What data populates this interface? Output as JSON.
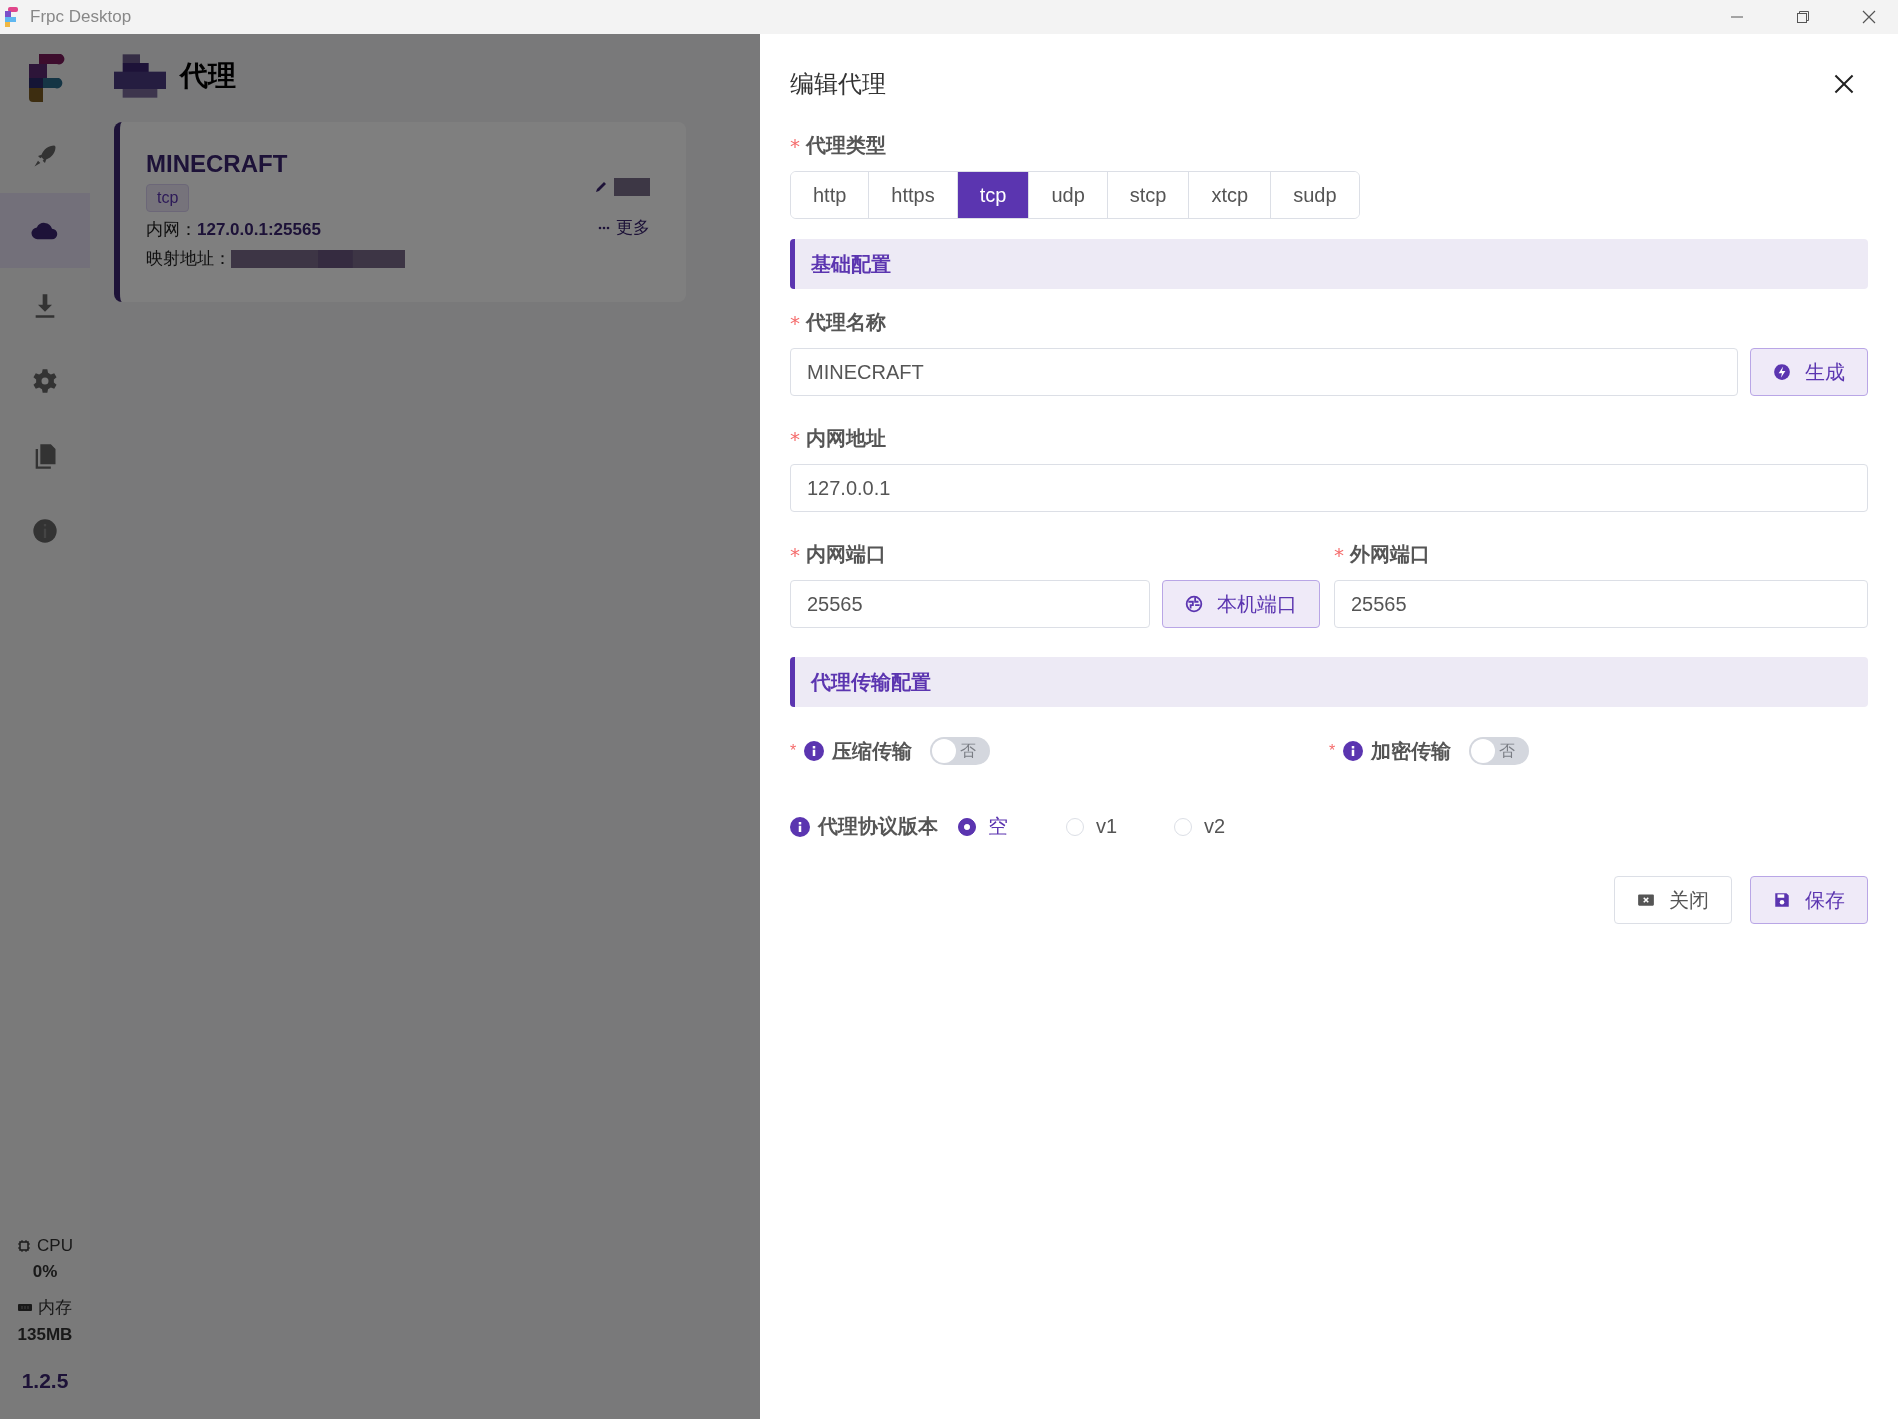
{
  "window": {
    "title": "Frpc Desktop"
  },
  "sidebar": {
    "items": [
      {
        "selected": false
      },
      {
        "selected": true
      },
      {
        "selected": false
      },
      {
        "selected": false
      },
      {
        "selected": false
      },
      {
        "selected": false
      }
    ],
    "stats": [
      {
        "kind": "cpu",
        "label": "CPU",
        "value": "0%"
      },
      {
        "kind": "memory",
        "label": "内存",
        "value": "135MB"
      }
    ],
    "version": "1.2.5"
  },
  "page": {
    "title": "代理",
    "card": {
      "name": "MINECRAFT",
      "tag": "tcp",
      "local_label": "内网：",
      "local_value": "127.0.0.1:25565",
      "mapping_label": "映射地址：",
      "more": "更多"
    }
  },
  "drawer": {
    "title": "编辑代理",
    "type_field": {
      "label": "代理类型",
      "mark": "*",
      "options": [
        {
          "label": "http",
          "selected": false
        },
        {
          "label": "https",
          "selected": false
        },
        {
          "label": "tcp",
          "selected": true
        },
        {
          "label": "udp",
          "selected": false
        },
        {
          "label": "stcp",
          "selected": false
        },
        {
          "label": "xtcp",
          "selected": false
        },
        {
          "label": "sudp",
          "selected": false
        }
      ]
    },
    "section_basic": "基础配置",
    "name_field": {
      "label": "代理名称",
      "mark": "*",
      "value": "MINECRAFT",
      "button": "生成"
    },
    "address_field": {
      "label": "内网地址",
      "mark": "*",
      "value": "127.0.0.1"
    },
    "local_port": {
      "label": "内网端口",
      "mark": "*",
      "value": "25565",
      "button": "本机端口"
    },
    "remote_port": {
      "label": "外网端口",
      "mark": "*",
      "value": "25565"
    },
    "section_transport": "代理传输配置",
    "switches": [
      {
        "label": "压缩传输",
        "mark": "*",
        "on": false,
        "text": "否"
      },
      {
        "label": "加密传输",
        "mark": "*",
        "on": false,
        "text": "否"
      }
    ],
    "protocol": {
      "label": "代理协议版本",
      "options": [
        {
          "label": "空",
          "selected": true
        },
        {
          "label": "v1",
          "selected": false
        },
        {
          "label": "v2",
          "selected": false
        }
      ]
    },
    "buttons": [
      {
        "kind": "close",
        "label": "关闭"
      },
      {
        "kind": "save",
        "label": "保存"
      }
    ]
  }
}
